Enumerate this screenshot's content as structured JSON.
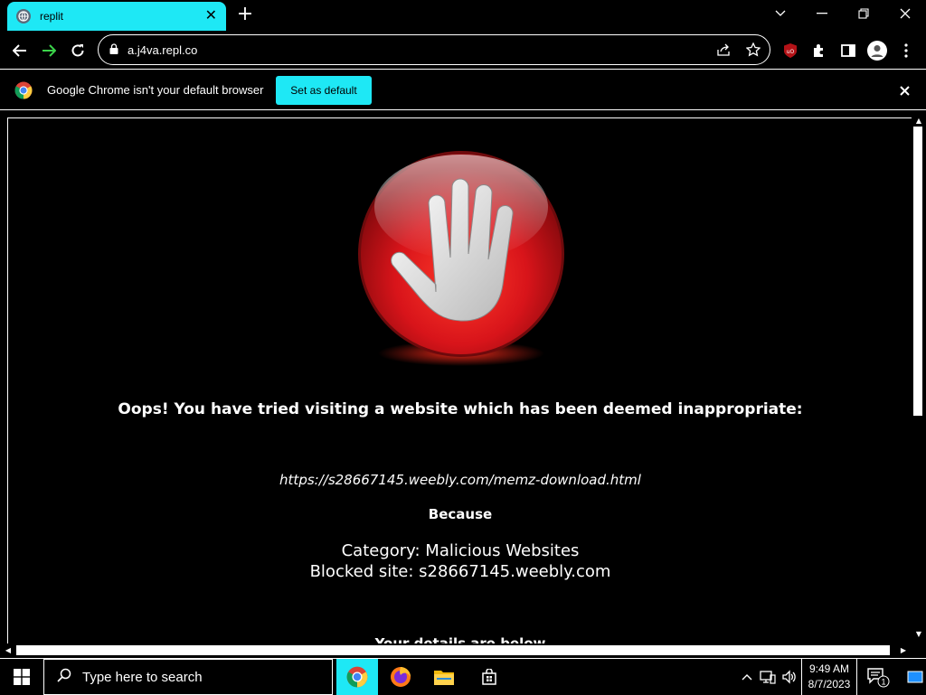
{
  "browser": {
    "tab": {
      "title": "replit"
    },
    "address": "a.j4va.repl.co",
    "infobar": {
      "message": "Google Chrome isn't your default browser",
      "button": "Set as default"
    }
  },
  "page": {
    "heading": "Oops! You have tried visiting a website which has been deemed inappropriate:",
    "url": "https://s28667145.weebly.com/memz-download.html",
    "because": "Because",
    "category": "Category: Malicious Websites",
    "blocked_site": "Blocked site: s28667145.weebly.com",
    "details": "Your details are below"
  },
  "taskbar": {
    "search_placeholder": "Type here to search",
    "time": "9:49 AM",
    "date": "8/7/2023",
    "notification_count": "1"
  },
  "colors": {
    "accent": "#1ee8f5",
    "stop_red": "#d8141a"
  }
}
